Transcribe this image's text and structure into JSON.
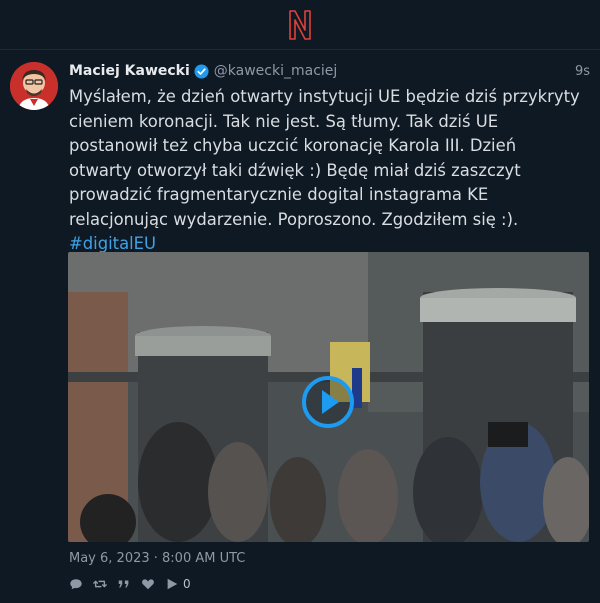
{
  "app": {
    "logo_letter": "N",
    "accent": "#e0403a",
    "link_color": "#3fa2e6",
    "verified_color": "#1d9bf0"
  },
  "post": {
    "author_name": "Maciej Kawecki",
    "handle": "@kawecki_maciej",
    "time_ago": "9s",
    "text": "Myślałem, że dzień otwarty instytucji UE będzie dziś przykryty\ncieniem koronacji. Tak nie jest. Są tłumy. Tak dziś UE\npostanowił też chyba uczcić koronację Karola III. Dzień\notwarty otworzył taki dźwięk :) Będę miał dziś zaszczyt\nprowadzić fragmentarycznie dogital instagrama KE\nrelacjonując wydarzenie. Poproszono. Zgodziłem się :).",
    "hashtag": "#digitalEU",
    "date": "May 6, 2023 · 8:00 AM UTC",
    "media_type": "video",
    "actions": {
      "reply_icon": "comment-icon",
      "retweet_icon": "retweet-icon",
      "quote_icon": "quote-icon",
      "like_icon": "heart-icon",
      "play_icon": "play-count-icon",
      "play_count": "0"
    }
  }
}
